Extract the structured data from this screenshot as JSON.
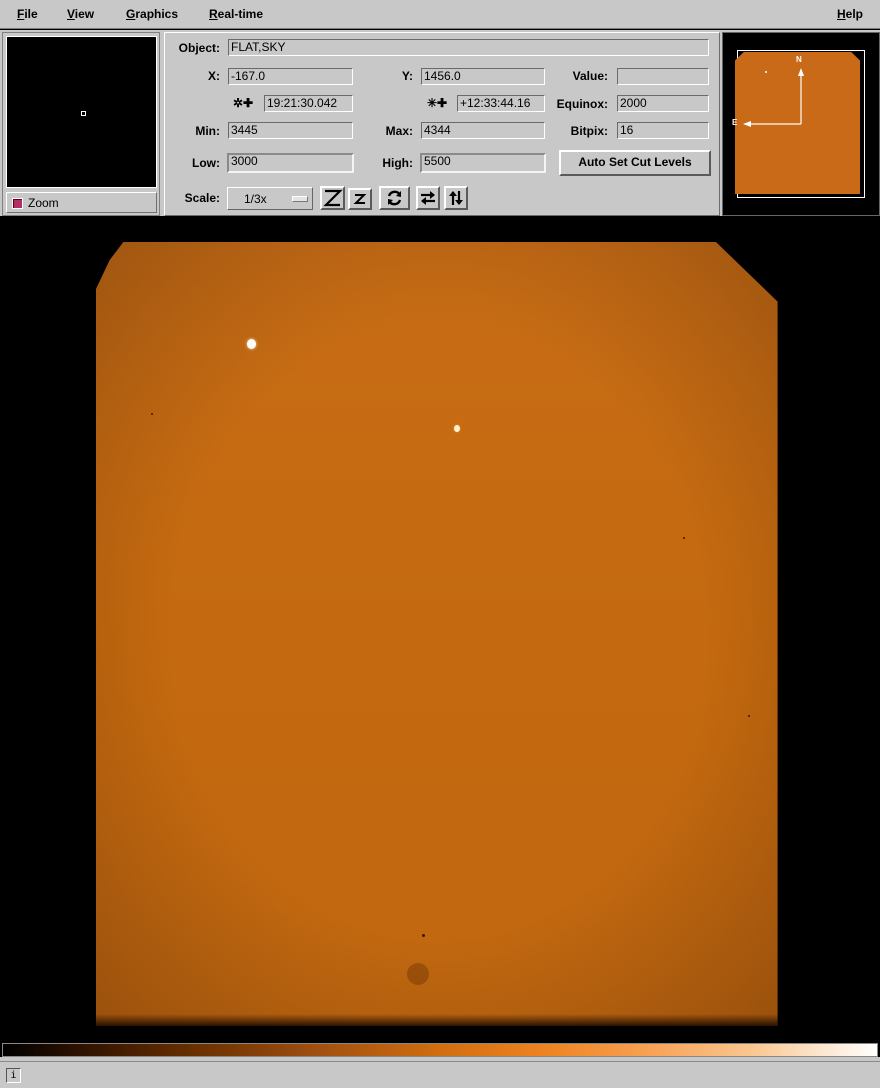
{
  "menubar": {
    "file": {
      "label_first": "F",
      "label_rest": "ile"
    },
    "view": {
      "label_first": "V",
      "label_rest": "iew"
    },
    "graphics": {
      "label_first": "G",
      "label_rest": "raphics"
    },
    "realtime": {
      "label_first": "R",
      "label_rest": "eal-time"
    },
    "help": {
      "label_first": "H",
      "label_rest": "elp"
    }
  },
  "zoom": {
    "label": "Zoom",
    "checked": true
  },
  "info": {
    "object_label": "Object:",
    "object_value": "FLAT,SKY",
    "x_label": "X:",
    "x_value": "-167.0",
    "y_label": "Y:",
    "y_value": "1456.0",
    "value_label": "Value:",
    "value_value": "",
    "ra_symbol": "✲✚",
    "ra_value": "19:21:30.042",
    "dec_symbol": "✳✚",
    "dec_value": "+12:33:44.16",
    "equinox_label": "Equinox:",
    "equinox_value": "2000",
    "min_label": "Min:",
    "min_value": "3445",
    "max_label": "Max:",
    "max_value": "4344",
    "bitpix_label": "Bitpix:",
    "bitpix_value": "16",
    "low_label": "Low:",
    "low_value": "3000",
    "high_label": "High:",
    "high_value": "5500",
    "auto_cut_label": "Auto Set Cut Levels",
    "scale_label": "Scale:",
    "scale_value": "1/3x"
  },
  "panner": {
    "north_label": "N",
    "east_label": "E"
  },
  "status": {
    "info_icon": "i"
  },
  "colors": {
    "image_orange": "#c86a16",
    "panel_gray": "#c8c8c8",
    "background": "#000000"
  }
}
